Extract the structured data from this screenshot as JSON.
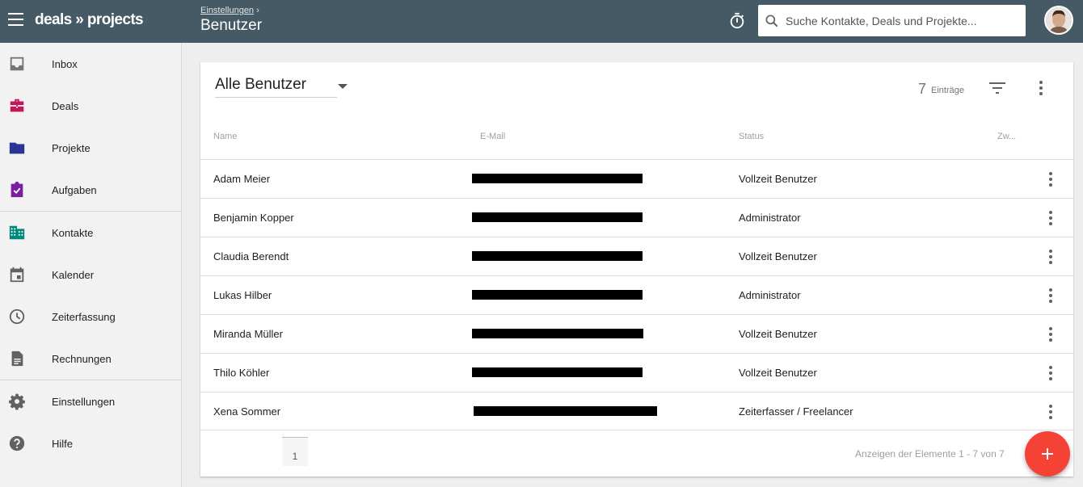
{
  "topbar": {
    "logo": "deals » projects",
    "breadcrumb": "Einstellungen",
    "breadcrumb_sep": "›",
    "title": "Benutzer",
    "search_placeholder": "Suche Kontakte, Deals und Projekte..."
  },
  "sidebar": {
    "items": [
      {
        "label": "Inbox",
        "icon": "inbox-icon",
        "color": "#757575"
      },
      {
        "label": "Deals",
        "icon": "briefcase-icon",
        "color": "#c2185b"
      },
      {
        "label": "Projekte",
        "icon": "folder-icon",
        "color": "#283593"
      },
      {
        "label": "Aufgaben",
        "icon": "task-check-icon",
        "color": "#7b1fa2"
      },
      {
        "label": "Kontakte",
        "icon": "building-icon",
        "color": "#00897b"
      },
      {
        "label": "Kalender",
        "icon": "calendar-icon",
        "color": "#616161"
      },
      {
        "label": "Zeiterfassung",
        "icon": "clock-icon",
        "color": "#616161"
      },
      {
        "label": "Rechnungen",
        "icon": "document-icon",
        "color": "#616161"
      },
      {
        "label": "Einstellungen",
        "icon": "gear-icon",
        "color": "#616161"
      },
      {
        "label": "Hilfe",
        "icon": "help-icon",
        "color": "#616161"
      }
    ]
  },
  "main": {
    "filter_label": "Alle Benutzer",
    "count": "7",
    "count_label": "Einträge",
    "columns": [
      "Name",
      "E-Mail",
      "Status",
      "Zw..."
    ],
    "rows": [
      {
        "name": "Adam Meier",
        "email": "[redacted]",
        "status": "Vollzeit Benutzer"
      },
      {
        "name": "Benjamin Kopper",
        "email": "[redacted]",
        "status": "Administrator"
      },
      {
        "name": "Claudia Berendt",
        "email": "[redacted]",
        "status": "Vollzeit Benutzer"
      },
      {
        "name": "Lukas Hilber",
        "email": "[redacted]",
        "status": "Administrator"
      },
      {
        "name": "Miranda Müller",
        "email": "[redacted]",
        "status": "Vollzeit Benutzer"
      },
      {
        "name": "Thilo Köhler",
        "email": "[redacted]",
        "status": "Vollzeit Benutzer"
      },
      {
        "name": "Xena Sommer",
        "email": "[redacted]",
        "status": "Zeiterfasser / Freelancer"
      }
    ],
    "page": "1",
    "footer": "Anzeigen der Elemente 1 - 7 von 7"
  },
  "colors": {
    "topbar": "#455a64",
    "fab": "#f44336"
  }
}
